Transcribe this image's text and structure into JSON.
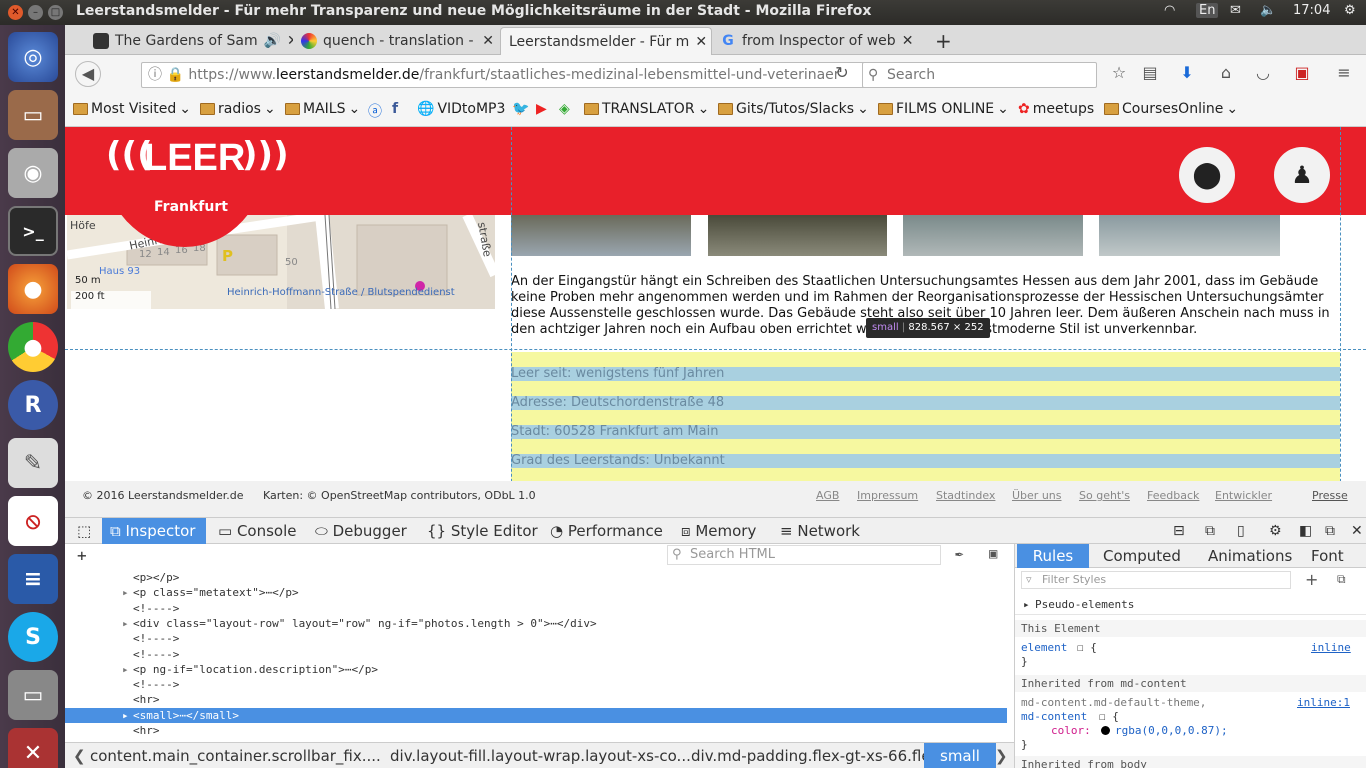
{
  "os": {
    "window_title": "Leerstandsmelder - Für mehr Transparenz und neue Möglichkeitsräume in der Stadt - Mozilla Firefox",
    "keyboard": "En",
    "clock": "17:04"
  },
  "tabs": [
    {
      "label": "The Gardens of Sam",
      "active": false
    },
    {
      "label": "quench - translation - E",
      "active": false
    },
    {
      "label": "Leerstandsmelder - Für m",
      "active": true
    },
    {
      "label": "from Inspector of web",
      "active": false
    }
  ],
  "navbar": {
    "url_prefix": "https://www.",
    "url_domain": "leerstandsmelder.de",
    "url_path": "/frankfurt/staatliches-medizinal-lebensmittel-und-veterinaer",
    "search_placeholder": "Search"
  },
  "bookmarks": [
    {
      "label": "Most Visited",
      "type": "folder"
    },
    {
      "label": "radios",
      "type": "folder"
    },
    {
      "label": "MAILS",
      "type": "folder"
    },
    {
      "label": "VIDtoMP3",
      "type": "link"
    },
    {
      "label": "TRANSLATOR",
      "type": "folder"
    },
    {
      "label": "Gits/Tutos/Slacks",
      "type": "folder"
    },
    {
      "label": "FILMS ONLINE",
      "type": "folder"
    },
    {
      "label": "meetups",
      "type": "link"
    },
    {
      "label": "CoursesOnline",
      "type": "folder"
    }
  ],
  "page": {
    "logo_text": "LEER",
    "city": "Frankfurt",
    "map": {
      "labels": [
        "Höfe",
        "Heinrich",
        "12",
        "14",
        "16",
        "18",
        "50",
        "P",
        "straße",
        "Haus 93",
        "Heinrich-Hoffmann-Straße / Blutspendedienst"
      ],
      "scale_m": "50 m",
      "scale_ft": "200 ft"
    },
    "description": "An der Eingangstür hängt ein Schreiben des Staatlichen Untersuchungsamtes Hessen aus dem Jahr 2001, dass im Gebäude keine Proben mehr angenommen werden und im Rahmen der Reorganisationsprozesse der Hessischen Untersuchungsämter diese Aussenstelle geschlossen wurde. Das Gebäude steht also seit über 10 Jahren leer. Dem äußeren Anschein nach muss in den achtziger Jahren noch ein Aufbau oben errichtet worden sein, der postmoderne Stil ist unverkennbar.",
    "tooltip": {
      "tag": "small",
      "size": "828.567 × 252"
    },
    "facts": [
      "Leer seit: wenigstens fünf Jahren",
      "Adresse: Deutschordenstraße 48",
      "Stadt: 60528 Frankfurt am Main",
      "Grad des Leerstands: Unbekannt"
    ],
    "footer": {
      "copyright": "© 2016 Leerstandsmelder.de",
      "maps": "Karten: © OpenStreetMap contributors, ODbL 1.0",
      "links": [
        "AGB",
        "Impressum",
        "Stadtindex",
        "Über uns",
        "So geht's",
        "Feedback",
        "Entwickler",
        "Presse"
      ]
    }
  },
  "devtools": {
    "tabs": [
      "Inspector",
      "Console",
      "Debugger",
      "Style Editor",
      "Performance",
      "Memory",
      "Network"
    ],
    "search_html_placeholder": "Search HTML",
    "markup": [
      {
        "text": "<p></p>",
        "indent": 0,
        "selected": false
      },
      {
        "text": "<p class=\"metatext\">⋯</p>",
        "indent": 0,
        "selected": false
      },
      {
        "text": "<!---->",
        "indent": 0,
        "selected": false
      },
      {
        "text": "<div class=\"layout-row\" layout=\"row\" ng-if=\"photos.length > 0\">⋯</div>",
        "indent": 0,
        "selected": false
      },
      {
        "text": "<!---->",
        "indent": 0,
        "selected": false
      },
      {
        "text": "<!---->",
        "indent": 0,
        "selected": false
      },
      {
        "text": "<p ng-if=\"location.description\">⋯</p>",
        "indent": 0,
        "selected": false
      },
      {
        "text": "<!---->",
        "indent": 0,
        "selected": false
      },
      {
        "text": "<hr>",
        "indent": 0,
        "selected": false
      },
      {
        "text": "<small>⋯</small>",
        "indent": 0,
        "selected": true
      },
      {
        "text": "<hr>",
        "indent": 0,
        "selected": false
      }
    ],
    "breadcrumbs": [
      "content.main_container.scrollbar_fix....",
      "div.layout-fill.layout-wrap.layout-xs-co...",
      "div.md-padding.flex-gt-xs-66.flex",
      "small"
    ],
    "side_tabs": [
      "Rules",
      "Computed",
      "Animations",
      "Font"
    ],
    "filter_placeholder": "Filter Styles",
    "rules": {
      "pseudo": "Pseudo-elements",
      "this_element": "This Element",
      "element_selector": "element",
      "inline": "inline",
      "inherited_md": "Inherited from md-content",
      "md_selector_1": "md-content.md-default-theme,",
      "md_selector_2": "md-content",
      "inline_1": "inline:1",
      "prop": "color:",
      "value": "rgba(0,0,0,0.87);",
      "inherited_body": "Inherited from body"
    }
  },
  "colors": {
    "brand_red": "#e8202a",
    "devtools_accent": "#4a90e2"
  }
}
